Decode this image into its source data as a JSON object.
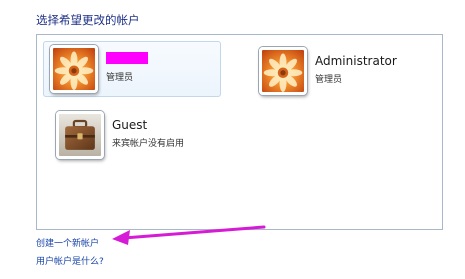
{
  "heading": "选择希望更改的帐户",
  "accounts": [
    {
      "name": "",
      "role": "管理员",
      "picture": "flower-orange-icon",
      "selected": true,
      "name_redacted": true
    },
    {
      "name": "Administrator",
      "role": "管理员",
      "picture": "flower-orange-icon",
      "selected": false
    },
    {
      "name": "Guest",
      "role": "来宾帐户没有启用",
      "picture": "briefcase-icon",
      "selected": false
    }
  ],
  "links": {
    "create_account": "创建一个新帐户",
    "what_is_account": "用户帐户是什么?"
  },
  "colors": {
    "heading": "#1e3287",
    "link": "#1a45a8",
    "annotation_arrow": "#d61bd6",
    "redaction": "#ff00ff"
  }
}
